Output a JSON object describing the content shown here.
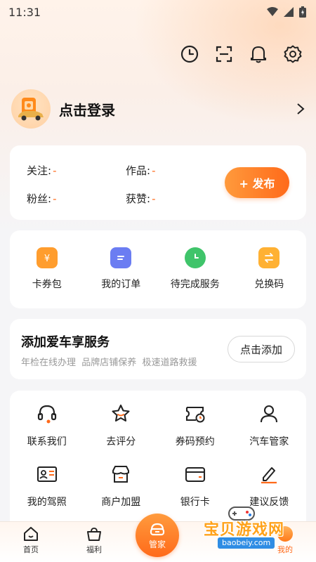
{
  "status": {
    "time": "11:31"
  },
  "toolbar": {
    "icons": [
      "clock-icon",
      "scan-icon",
      "bell-icon",
      "gear-icon"
    ]
  },
  "profile": {
    "login_text": "点击登录"
  },
  "stats": {
    "follow_label": "关注:",
    "follow_value": "-",
    "works_label": "作品:",
    "works_value": "-",
    "fans_label": "粉丝:",
    "fans_value": "-",
    "likes_label": "获赞:",
    "likes_value": "-",
    "publish_label": "+ 发布"
  },
  "quick": [
    {
      "label": "卡券包",
      "icon": "coupon-icon",
      "color": "#ff9d2e"
    },
    {
      "label": "我的订单",
      "icon": "order-icon",
      "color": "#6b7df2"
    },
    {
      "label": "待完成服务",
      "icon": "alarm-clock-icon",
      "color": "#3fc46a"
    },
    {
      "label": "兑换码",
      "icon": "exchange-icon",
      "color": "#ffb133"
    }
  ],
  "promo": {
    "title": "添加爱车享服务",
    "subtitle": "年检在线办理  品牌店铺保养  极速道路救援",
    "button": "点击添加"
  },
  "services": [
    {
      "label": "联系我们",
      "icon": "headset-icon"
    },
    {
      "label": "去评分",
      "icon": "star-icon"
    },
    {
      "label": "券码预约",
      "icon": "ticket-clock-icon"
    },
    {
      "label": "汽车管家",
      "icon": "user-icon"
    },
    {
      "label": "我的驾照",
      "icon": "id-card-icon"
    },
    {
      "label": "商户加盟",
      "icon": "store-icon"
    },
    {
      "label": "银行卡",
      "icon": "bank-card-icon"
    },
    {
      "label": "建议反馈",
      "icon": "edit-icon"
    }
  ],
  "tabbar": {
    "home": "首页",
    "welfare": "福利",
    "center": "管家",
    "mine": "我的"
  },
  "watermark": {
    "text": "宝贝游戏网",
    "url": "baobeiy.com"
  },
  "colors": {
    "accent": "#ff6a1a",
    "accent_light": "#ff9a3c"
  }
}
